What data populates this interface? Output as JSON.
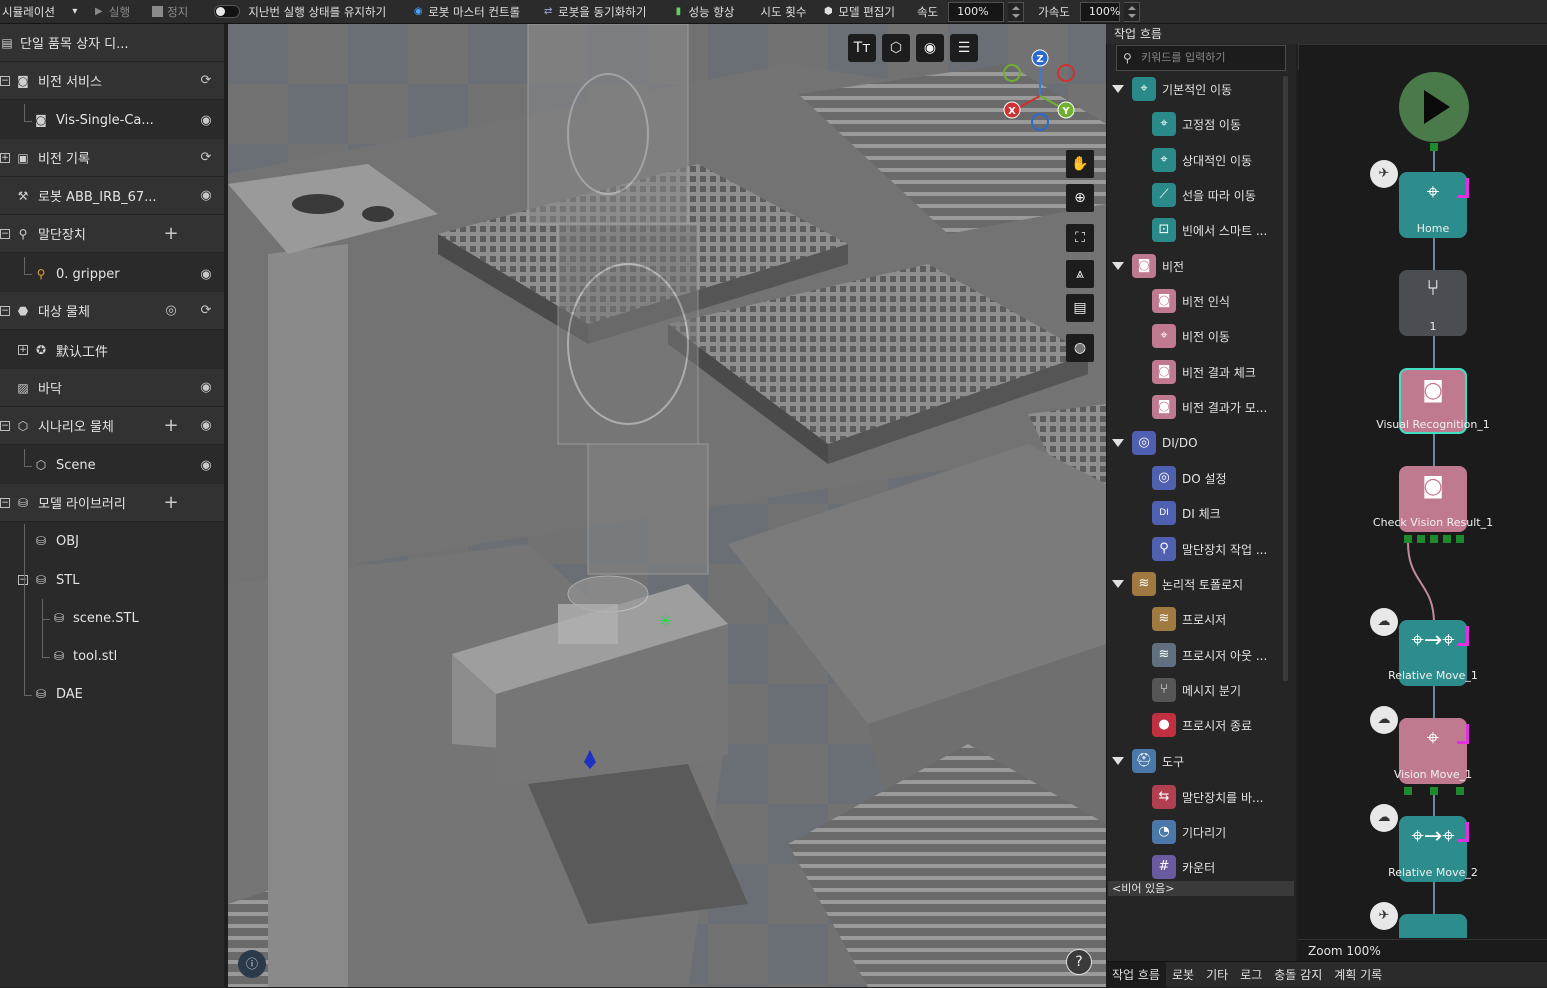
{
  "toolbar": {
    "simulation": "시뮬레이션",
    "run": "실행",
    "stop": "정지",
    "keep_state": "지난번 실행 상태를 유지하기",
    "robot_master": "로봇 마스터 컨트롤",
    "sync_robot": "로봇을 동기화하기",
    "perf": "성능 향상",
    "attempts": "시도 횟수",
    "model_editor": "모델 편집기",
    "speed_label": "속도",
    "speed_value": "100%",
    "accel_label": "가속도",
    "accel_value": "100%"
  },
  "tree": {
    "root": "단일 품목 상자 디...",
    "vision_service": "비전 서비스",
    "vis_single": "Vis-Single-Ca...",
    "vision_record": "비전 기록",
    "robot": "로봇 ABB_IRB_67...",
    "end_effector": "말단장치",
    "gripper": "0. gripper",
    "target_object": "대상 물체",
    "default_workpiece": "默认工件",
    "floor": "바닥",
    "scenario_object": "시나리오 물체",
    "scene": "Scene",
    "model_library": "모델 라이브러리",
    "obj": "OBJ",
    "stl": "STL",
    "scene_stl": "scene.STL",
    "tool_stl": "tool.stl",
    "dae": "DAE"
  },
  "gizmo": {
    "z": "Z",
    "x": "X",
    "y": "Y"
  },
  "palette": {
    "title": "작업 흐름",
    "search_placeholder": "키워드를 입력하기",
    "basic_move": "기본적인 이동",
    "fixed_move": "고정점 이동",
    "relative_move": "상대적인 이동",
    "line_move": "선을 따라 이동",
    "smart_pick": "빈에서 스마트 ...",
    "vision": "비전",
    "vision_recognition": "비전 인식",
    "vision_move": "비전 이동",
    "vision_check": "비전 결과 체크",
    "vision_result_model": "비전 결과가 모...",
    "dido": "DI/DO",
    "do_set": "DO 설정",
    "di_check": "DI 체크",
    "ee_action": "말단장치 작업 ...",
    "logic": "논리적 토폴로지",
    "procedure": "프로시저",
    "procedure_out": "프로시저 아웃 ...",
    "message_branch": "메시지 분기",
    "procedure_end": "프로시저 종료",
    "tools": "도구",
    "change_ee": "말단장치를 바...",
    "wait": "기다리기",
    "counter": "카운터",
    "empty": "<비어 있음>"
  },
  "canvas": {
    "home": "Home",
    "branch_num": "1",
    "visual_recognition": "Visual Recognition_1",
    "check_vision": "Check Vision Result_1",
    "relative_move_1": "Relative Move_1",
    "vision_move_1": "Vision Move_1",
    "relative_move_2": "Relative Move_2",
    "zoom": "Zoom 100%"
  },
  "bottom_tabs": [
    "작업 흐름",
    "로봇",
    "기타",
    "로그",
    "충돌 감지",
    "계획 기록"
  ]
}
